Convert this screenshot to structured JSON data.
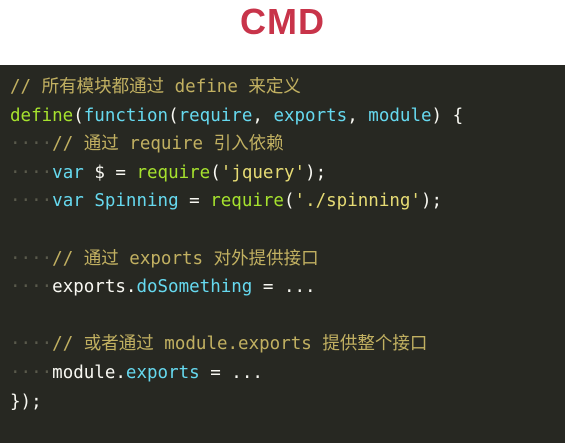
{
  "title": "CMD",
  "code": {
    "lines": [
      [
        {
          "c": "tok-comment",
          "t": "// 所有模块都通过 define 来定义"
        }
      ],
      [
        {
          "c": "tok-fn",
          "t": "define"
        },
        {
          "c": "tok-plain",
          "t": "("
        },
        {
          "c": "tok-kw",
          "t": "function"
        },
        {
          "c": "tok-plain",
          "t": "("
        },
        {
          "c": "tok-kw",
          "t": "require"
        },
        {
          "c": "tok-plain",
          "t": ", "
        },
        {
          "c": "tok-kw",
          "t": "exports"
        },
        {
          "c": "tok-plain",
          "t": ", "
        },
        {
          "c": "tok-kw",
          "t": "module"
        },
        {
          "c": "tok-plain",
          "t": ") {"
        }
      ],
      [
        {
          "c": "ws-dots",
          "t": "····"
        },
        {
          "c": "tok-comment",
          "t": "// 通过 require 引入依赖"
        }
      ],
      [
        {
          "c": "ws-dots",
          "t": "····"
        },
        {
          "c": "tok-kw",
          "t": "var"
        },
        {
          "c": "tok-plain",
          "t": " "
        },
        {
          "c": "tok-var",
          "t": "$"
        },
        {
          "c": "tok-plain",
          "t": " = "
        },
        {
          "c": "tok-fn",
          "t": "require"
        },
        {
          "c": "tok-plain",
          "t": "("
        },
        {
          "c": "tok-str",
          "t": "'jquery'"
        },
        {
          "c": "tok-plain",
          "t": ");"
        }
      ],
      [
        {
          "c": "ws-dots",
          "t": "····"
        },
        {
          "c": "tok-kw",
          "t": "var"
        },
        {
          "c": "tok-plain",
          "t": " "
        },
        {
          "c": "tok-spin",
          "t": "Spinning"
        },
        {
          "c": "tok-plain",
          "t": " = "
        },
        {
          "c": "tok-fn",
          "t": "require"
        },
        {
          "c": "tok-plain",
          "t": "("
        },
        {
          "c": "tok-str",
          "t": "'./spinning'"
        },
        {
          "c": "tok-plain",
          "t": ");"
        }
      ],
      [
        {
          "c": "tok-plain",
          "t": ""
        }
      ],
      [
        {
          "c": "ws-dots",
          "t": "····"
        },
        {
          "c": "tok-comment",
          "t": "// 通过 exports 对外提供接口"
        }
      ],
      [
        {
          "c": "ws-dots",
          "t": "····"
        },
        {
          "c": "tok-plain",
          "t": "exports."
        },
        {
          "c": "tok-prop",
          "t": "doSomething"
        },
        {
          "c": "tok-plain",
          "t": " = ..."
        }
      ],
      [
        {
          "c": "tok-plain",
          "t": ""
        }
      ],
      [
        {
          "c": "ws-dots",
          "t": "····"
        },
        {
          "c": "tok-comment",
          "t": "// 或者通过 module.exports 提供整个接口"
        }
      ],
      [
        {
          "c": "ws-dots",
          "t": "····"
        },
        {
          "c": "tok-plain",
          "t": "module."
        },
        {
          "c": "tok-prop",
          "t": "exports"
        },
        {
          "c": "tok-plain",
          "t": " = ..."
        }
      ],
      [
        {
          "c": "tok-plain",
          "t": "});"
        }
      ]
    ]
  },
  "colors": {
    "title": "#c8344a",
    "editor_bg": "#272822",
    "comment": "#d7c36a",
    "keyword": "#66d9ef",
    "function": "#a6e22e",
    "string": "#e6db74",
    "plain": "#f8f8f2"
  }
}
